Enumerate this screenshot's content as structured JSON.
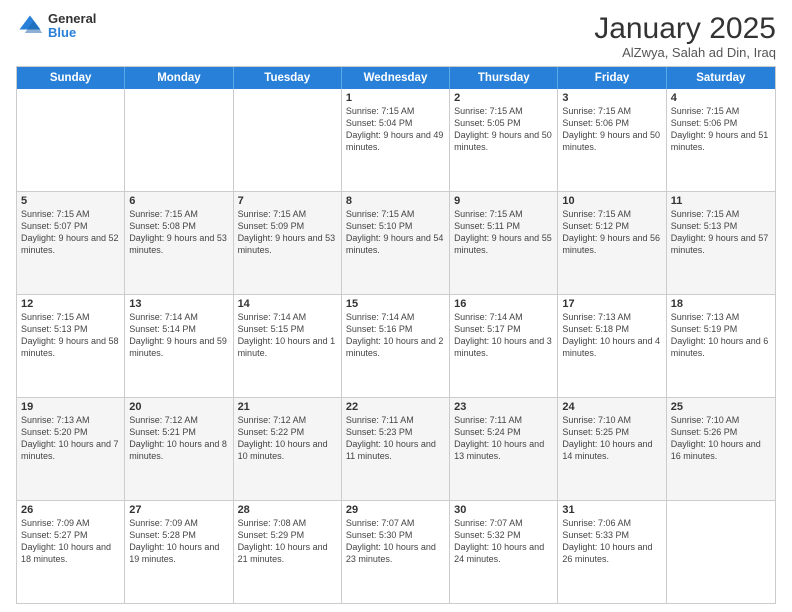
{
  "logo": {
    "general": "General",
    "blue": "Blue"
  },
  "header": {
    "title": "January 2025",
    "subtitle": "AlZwya, Salah ad Din, Iraq"
  },
  "days": [
    "Sunday",
    "Monday",
    "Tuesday",
    "Wednesday",
    "Thursday",
    "Friday",
    "Saturday"
  ],
  "weeks": [
    [
      {
        "num": "",
        "sunrise": "",
        "sunset": "",
        "daylight": "",
        "empty": true
      },
      {
        "num": "",
        "sunrise": "",
        "sunset": "",
        "daylight": "",
        "empty": true
      },
      {
        "num": "",
        "sunrise": "",
        "sunset": "",
        "daylight": "",
        "empty": true
      },
      {
        "num": "1",
        "sunrise": "Sunrise: 7:15 AM",
        "sunset": "Sunset: 5:04 PM",
        "daylight": "Daylight: 9 hours and 49 minutes."
      },
      {
        "num": "2",
        "sunrise": "Sunrise: 7:15 AM",
        "sunset": "Sunset: 5:05 PM",
        "daylight": "Daylight: 9 hours and 50 minutes."
      },
      {
        "num": "3",
        "sunrise": "Sunrise: 7:15 AM",
        "sunset": "Sunset: 5:06 PM",
        "daylight": "Daylight: 9 hours and 50 minutes."
      },
      {
        "num": "4",
        "sunrise": "Sunrise: 7:15 AM",
        "sunset": "Sunset: 5:06 PM",
        "daylight": "Daylight: 9 hours and 51 minutes."
      }
    ],
    [
      {
        "num": "5",
        "sunrise": "Sunrise: 7:15 AM",
        "sunset": "Sunset: 5:07 PM",
        "daylight": "Daylight: 9 hours and 52 minutes."
      },
      {
        "num": "6",
        "sunrise": "Sunrise: 7:15 AM",
        "sunset": "Sunset: 5:08 PM",
        "daylight": "Daylight: 9 hours and 53 minutes."
      },
      {
        "num": "7",
        "sunrise": "Sunrise: 7:15 AM",
        "sunset": "Sunset: 5:09 PM",
        "daylight": "Daylight: 9 hours and 53 minutes."
      },
      {
        "num": "8",
        "sunrise": "Sunrise: 7:15 AM",
        "sunset": "Sunset: 5:10 PM",
        "daylight": "Daylight: 9 hours and 54 minutes."
      },
      {
        "num": "9",
        "sunrise": "Sunrise: 7:15 AM",
        "sunset": "Sunset: 5:11 PM",
        "daylight": "Daylight: 9 hours and 55 minutes."
      },
      {
        "num": "10",
        "sunrise": "Sunrise: 7:15 AM",
        "sunset": "Sunset: 5:12 PM",
        "daylight": "Daylight: 9 hours and 56 minutes."
      },
      {
        "num": "11",
        "sunrise": "Sunrise: 7:15 AM",
        "sunset": "Sunset: 5:13 PM",
        "daylight": "Daylight: 9 hours and 57 minutes."
      }
    ],
    [
      {
        "num": "12",
        "sunrise": "Sunrise: 7:15 AM",
        "sunset": "Sunset: 5:13 PM",
        "daylight": "Daylight: 9 hours and 58 minutes."
      },
      {
        "num": "13",
        "sunrise": "Sunrise: 7:14 AM",
        "sunset": "Sunset: 5:14 PM",
        "daylight": "Daylight: 9 hours and 59 minutes."
      },
      {
        "num": "14",
        "sunrise": "Sunrise: 7:14 AM",
        "sunset": "Sunset: 5:15 PM",
        "daylight": "Daylight: 10 hours and 1 minute."
      },
      {
        "num": "15",
        "sunrise": "Sunrise: 7:14 AM",
        "sunset": "Sunset: 5:16 PM",
        "daylight": "Daylight: 10 hours and 2 minutes."
      },
      {
        "num": "16",
        "sunrise": "Sunrise: 7:14 AM",
        "sunset": "Sunset: 5:17 PM",
        "daylight": "Daylight: 10 hours and 3 minutes."
      },
      {
        "num": "17",
        "sunrise": "Sunrise: 7:13 AM",
        "sunset": "Sunset: 5:18 PM",
        "daylight": "Daylight: 10 hours and 4 minutes."
      },
      {
        "num": "18",
        "sunrise": "Sunrise: 7:13 AM",
        "sunset": "Sunset: 5:19 PM",
        "daylight": "Daylight: 10 hours and 6 minutes."
      }
    ],
    [
      {
        "num": "19",
        "sunrise": "Sunrise: 7:13 AM",
        "sunset": "Sunset: 5:20 PM",
        "daylight": "Daylight: 10 hours and 7 minutes."
      },
      {
        "num": "20",
        "sunrise": "Sunrise: 7:12 AM",
        "sunset": "Sunset: 5:21 PM",
        "daylight": "Daylight: 10 hours and 8 minutes."
      },
      {
        "num": "21",
        "sunrise": "Sunrise: 7:12 AM",
        "sunset": "Sunset: 5:22 PM",
        "daylight": "Daylight: 10 hours and 10 minutes."
      },
      {
        "num": "22",
        "sunrise": "Sunrise: 7:11 AM",
        "sunset": "Sunset: 5:23 PM",
        "daylight": "Daylight: 10 hours and 11 minutes."
      },
      {
        "num": "23",
        "sunrise": "Sunrise: 7:11 AM",
        "sunset": "Sunset: 5:24 PM",
        "daylight": "Daylight: 10 hours and 13 minutes."
      },
      {
        "num": "24",
        "sunrise": "Sunrise: 7:10 AM",
        "sunset": "Sunset: 5:25 PM",
        "daylight": "Daylight: 10 hours and 14 minutes."
      },
      {
        "num": "25",
        "sunrise": "Sunrise: 7:10 AM",
        "sunset": "Sunset: 5:26 PM",
        "daylight": "Daylight: 10 hours and 16 minutes."
      }
    ],
    [
      {
        "num": "26",
        "sunrise": "Sunrise: 7:09 AM",
        "sunset": "Sunset: 5:27 PM",
        "daylight": "Daylight: 10 hours and 18 minutes."
      },
      {
        "num": "27",
        "sunrise": "Sunrise: 7:09 AM",
        "sunset": "Sunset: 5:28 PM",
        "daylight": "Daylight: 10 hours and 19 minutes."
      },
      {
        "num": "28",
        "sunrise": "Sunrise: 7:08 AM",
        "sunset": "Sunset: 5:29 PM",
        "daylight": "Daylight: 10 hours and 21 minutes."
      },
      {
        "num": "29",
        "sunrise": "Sunrise: 7:07 AM",
        "sunset": "Sunset: 5:30 PM",
        "daylight": "Daylight: 10 hours and 23 minutes."
      },
      {
        "num": "30",
        "sunrise": "Sunrise: 7:07 AM",
        "sunset": "Sunset: 5:32 PM",
        "daylight": "Daylight: 10 hours and 24 minutes."
      },
      {
        "num": "31",
        "sunrise": "Sunrise: 7:06 AM",
        "sunset": "Sunset: 5:33 PM",
        "daylight": "Daylight: 10 hours and 26 minutes."
      },
      {
        "num": "",
        "sunrise": "",
        "sunset": "",
        "daylight": "",
        "empty": true
      }
    ]
  ]
}
